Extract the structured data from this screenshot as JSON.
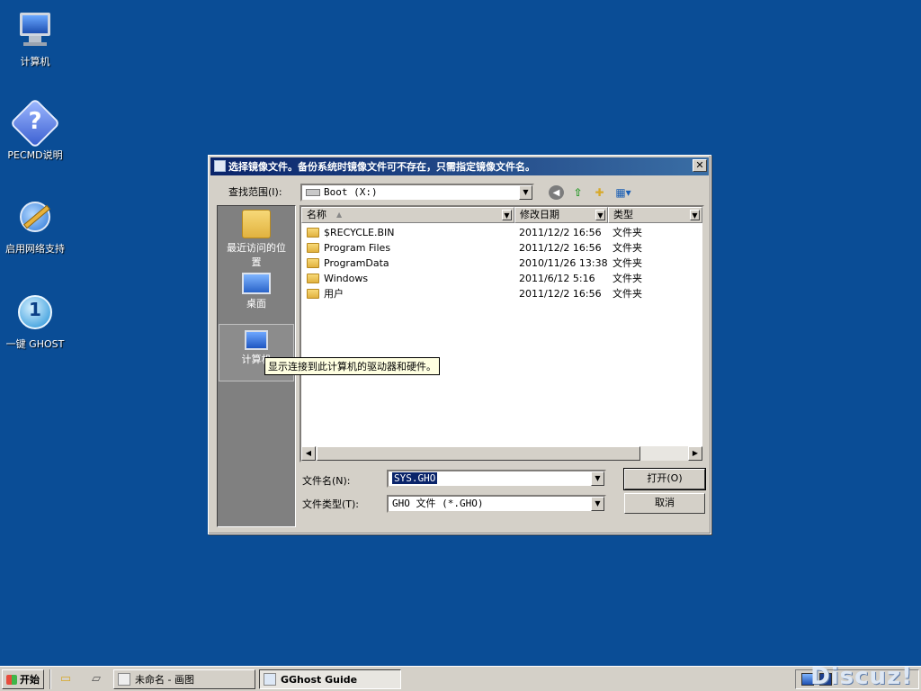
{
  "desktop": {
    "icons": [
      {
        "label": "计算机"
      },
      {
        "label": "PECMD说明"
      },
      {
        "label": "启用网络支持"
      },
      {
        "label": "一键 GHOST"
      }
    ]
  },
  "dialog": {
    "title": "选择镜像文件。备份系统时镜像文件可不存在，只需指定镜像文件名。",
    "close_glyph": "✕",
    "lookin_label": "查找范围(I):",
    "lookin_value": "Boot (X:)",
    "places": [
      {
        "label": "最近访问的位置"
      },
      {
        "label": "桌面"
      },
      {
        "label": "计算机"
      }
    ],
    "columns": [
      "名称",
      "修改日期",
      "类型"
    ],
    "files": [
      {
        "name": "$RECYCLE.BIN",
        "date": "2011/12/2 16:56",
        "type": "文件夹"
      },
      {
        "name": "Program Files",
        "date": "2011/12/2 16:56",
        "type": "文件夹"
      },
      {
        "name": "ProgramData",
        "date": "2010/11/26 13:38",
        "type": "文件夹"
      },
      {
        "name": "Windows",
        "date": "2011/6/12 5:16",
        "type": "文件夹"
      },
      {
        "name": "用户",
        "date": "2011/12/2 16:56",
        "type": "文件夹"
      }
    ],
    "filename_label": "文件名(N):",
    "filename_value": "SYS.GHO",
    "filetype_label": "文件类型(T):",
    "filetype_value": "GHO 文件 (*.GHO)",
    "open_button": "打开(O)",
    "cancel_button": "取消",
    "tooltip": "显示连接到此计算机的驱动器和硬件。"
  },
  "taskbar": {
    "start_label": "开始",
    "tasks": [
      {
        "label": "未命名 - 画图"
      },
      {
        "label": "GGhost Guide"
      }
    ]
  },
  "watermark": "Discuz!",
  "colors": {
    "desktop": "#0a4d96",
    "titlebar_start": "#0a246a",
    "titlebar_end": "#3a6ea5",
    "tooltip_bg": "#ffffe1",
    "selection": "#0a246a"
  }
}
